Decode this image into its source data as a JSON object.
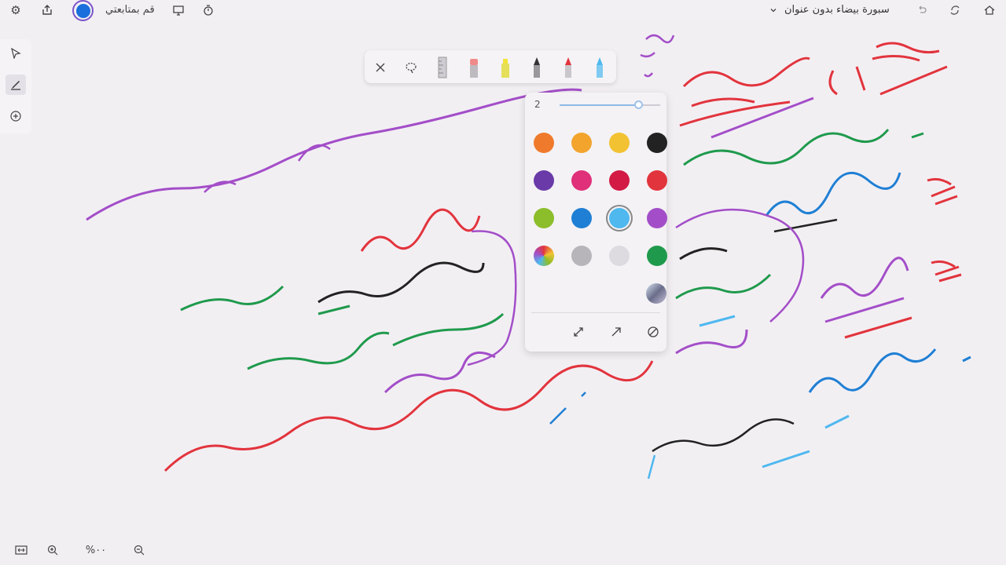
{
  "topbar": {
    "document_title": "سبورة بيضاء بدون عنوان",
    "follow_label": "قم بمتابعتي",
    "icons": [
      "settings-icon",
      "share-icon",
      "record-icon",
      "present-icon",
      "timer-icon",
      "home-icon",
      "sync-icon",
      "undo-icon",
      "chevron-down-icon"
    ]
  },
  "left_rail": {
    "tools": [
      "select-tool",
      "pen-tool",
      "add-tool"
    ]
  },
  "bottom_bar": {
    "zoom_label": "%٠٠",
    "icons": [
      "fit-screen-icon",
      "zoom-in-icon",
      "zoom-out-icon"
    ]
  },
  "pen_toolbar": {
    "tools": [
      "close-icon",
      "lasso-icon",
      "ruler-icon",
      "eraser-icon",
      "highlighter-yellow",
      "pen-black",
      "pen-red",
      "pen-blue"
    ],
    "active_tool": "pen-blue"
  },
  "color_panel": {
    "size_value": "2",
    "size_fraction": 0.78,
    "selected_color": "#4fb8ef",
    "colors": [
      [
        "#f07a2c",
        "#f2a42d",
        "#f2c232",
        "#222222"
      ],
      [
        "#6a3aa8",
        "#e0307a",
        "#d21a45",
        "#e2343d"
      ],
      [
        "#8cbd2a",
        "#1f7fd4",
        "#4fb8ef",
        "#a34ec8"
      ],
      [
        "rainbow",
        "#b7b5ba",
        "#dddbe0",
        "#1f9a4c"
      ]
    ],
    "extra_swatch": "gradient",
    "actions": [
      "expand-icon",
      "arrow-icon",
      "no-color-icon"
    ]
  },
  "colors": {
    "ink_red": "#e2343d",
    "ink_purple": "#a34ec8",
    "ink_green": "#1f9a4c",
    "ink_blue": "#1f7fd4",
    "ink_black": "#222222",
    "ink_cyan": "#4fb8ef"
  }
}
